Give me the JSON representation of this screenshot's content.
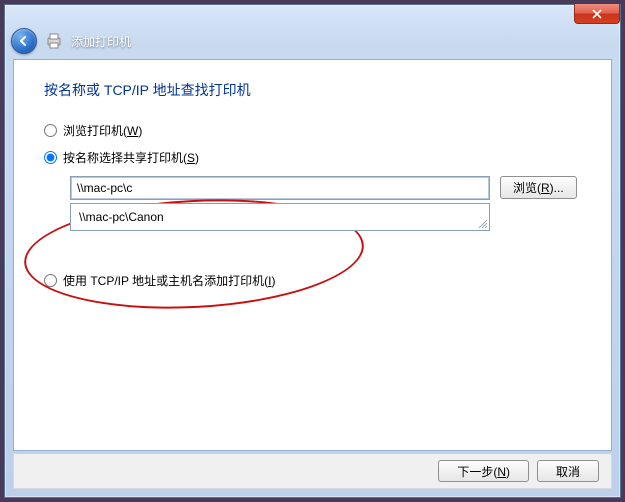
{
  "window": {
    "nav_title": "添加打印机"
  },
  "heading": "按名称或 TCP/IP 地址查找打印机",
  "options": {
    "browse": {
      "label_pre": "浏览打印机(",
      "mn": "W",
      "label_post": ")"
    },
    "by_name": {
      "label_pre": "按名称选择共享打印机(",
      "mn": "S",
      "label_post": ")"
    },
    "tcpip": {
      "label_pre": "使用 TCP/IP 地址或主机名添加打印机(",
      "mn": "I",
      "label_post": ")"
    },
    "selected": "by_name"
  },
  "path_input": {
    "value": "\\\\mac-pc\\c"
  },
  "dropdown": {
    "items": [
      "\\\\mac-pc\\Canon"
    ]
  },
  "browse_btn": {
    "pre": "浏览(",
    "mn": "R",
    "post": ")..."
  },
  "footer": {
    "next": {
      "pre": "下一步(",
      "mn": "N",
      "post": ")"
    },
    "cancel": "取消"
  }
}
